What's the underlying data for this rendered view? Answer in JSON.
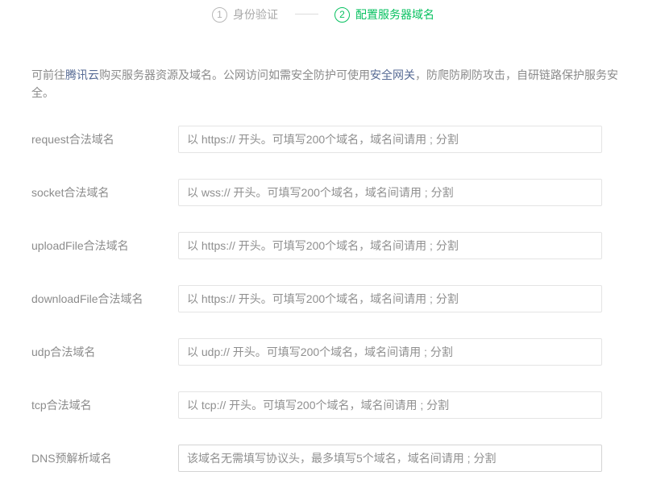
{
  "stepper": {
    "step1": {
      "number": "1",
      "label": "身份验证"
    },
    "step2": {
      "number": "2",
      "label": "配置服务器域名"
    }
  },
  "intro": {
    "text1": "可前往",
    "link1": "腾讯云",
    "text2": "购买服务器资源及域名。公网访问如需安全防护可使用",
    "link2": "安全网关",
    "text3": "，防爬防刷防攻击，自研链路保护服务安全。"
  },
  "fields": [
    {
      "label": "request合法域名",
      "placeholder": "以 https:// 开头。可填写200个域名，域名间请用 ; 分割",
      "value": ""
    },
    {
      "label": "socket合法域名",
      "placeholder": "以 wss:// 开头。可填写200个域名，域名间请用 ; 分割",
      "value": ""
    },
    {
      "label": "uploadFile合法域名",
      "placeholder": "以 https:// 开头。可填写200个域名，域名间请用 ; 分割",
      "value": ""
    },
    {
      "label": "downloadFile合法域名",
      "placeholder": "以 https:// 开头。可填写200个域名，域名间请用 ; 分割",
      "value": ""
    },
    {
      "label": "udp合法域名",
      "placeholder": "以 udp:// 开头。可填写200个域名，域名间请用 ; 分割",
      "value": ""
    },
    {
      "label": "tcp合法域名",
      "placeholder": "以 tcp:// 开头。可填写200个域名，域名间请用 ; 分割",
      "value": ""
    },
    {
      "label": "DNS预解析域名",
      "placeholder": "该域名无需填写协议头，最多填写5个域名，域名间请用 ; 分割",
      "value": ""
    }
  ],
  "colors": {
    "accent": "#07c160",
    "link": "#576b95",
    "muted_text": "#8c8c8c"
  }
}
